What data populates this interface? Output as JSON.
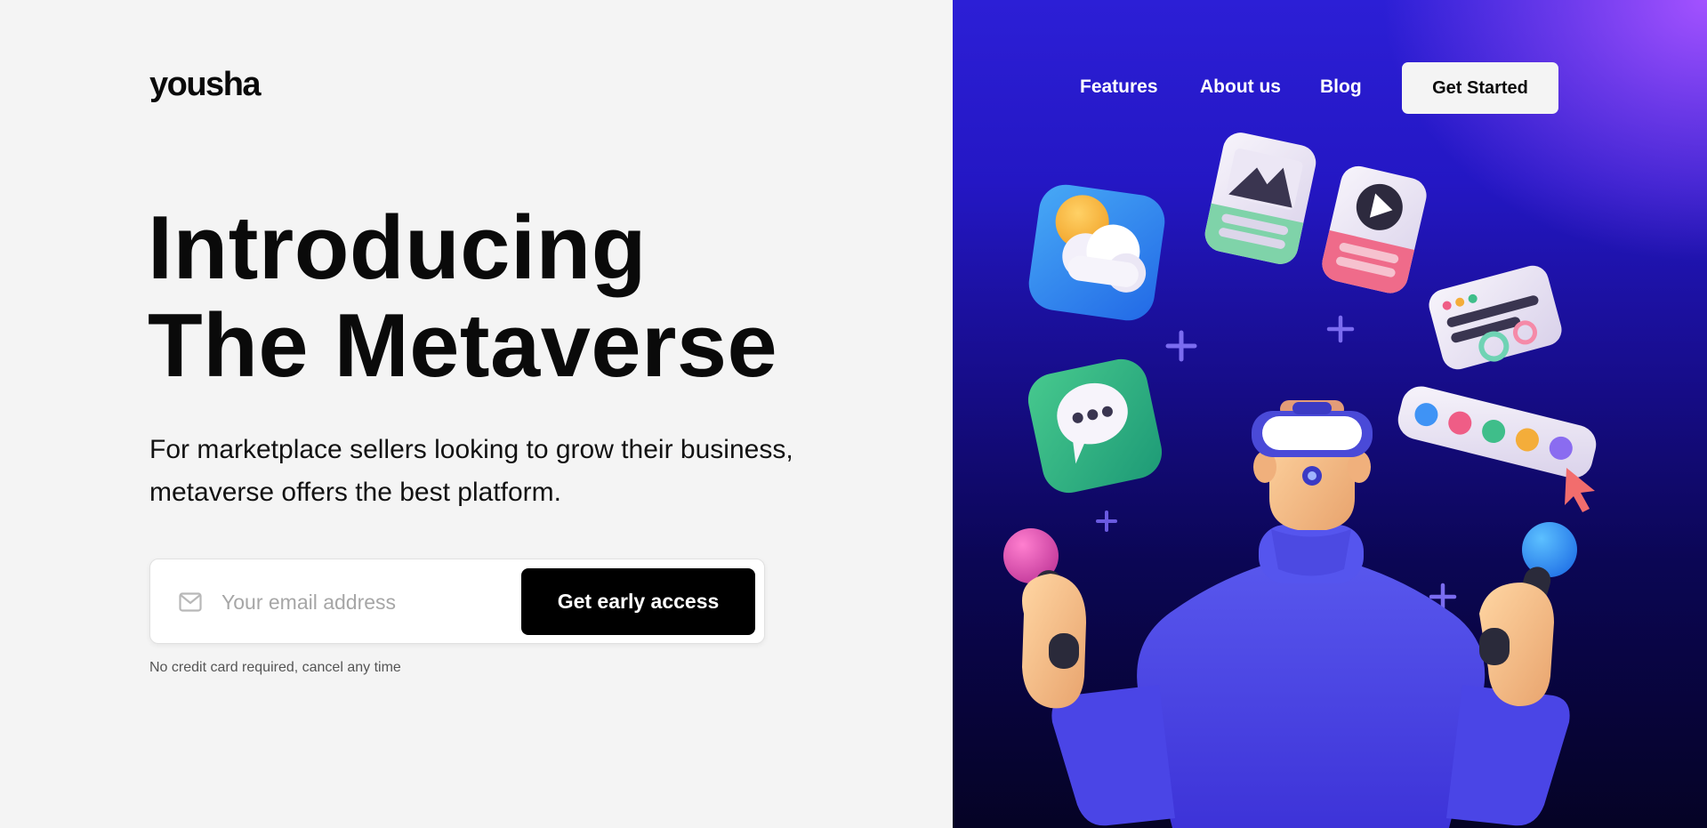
{
  "brand": {
    "logo": "yousha"
  },
  "nav": {
    "links": [
      "Features",
      "About us",
      "Blog"
    ],
    "cta_label": "Get Started"
  },
  "hero": {
    "headline_line1": "Introducing",
    "headline_line2": "The Metaverse",
    "subtitle_line1": "For marketplace sellers looking to grow their business,",
    "subtitle_line2": "metaverse offers the best platform."
  },
  "signup": {
    "email_placeholder": "Your email address",
    "email_value": "",
    "submit_label": "Get early access",
    "note": "No credit card required, cancel any time"
  },
  "icons": {
    "mail": "mail-icon",
    "weather": "weather-app-icon",
    "image": "image-card-icon",
    "play": "video-card-icon",
    "chat": "chat-bubble-icon",
    "text": "text-card-icon",
    "palette": "color-palette-icon",
    "cursor": "cursor-icon",
    "plus": "plus-icon"
  },
  "colors": {
    "cta_background": "#000000",
    "panel_gradient_top": "#2c1fd6",
    "panel_gradient_corner": "#a352ff",
    "panel_gradient_bottom": "#050325",
    "palette_dots": [
      "#3f93f5",
      "#ef5d86",
      "#3fbe8a",
      "#f4ad3a",
      "#8a6cf0"
    ]
  }
}
